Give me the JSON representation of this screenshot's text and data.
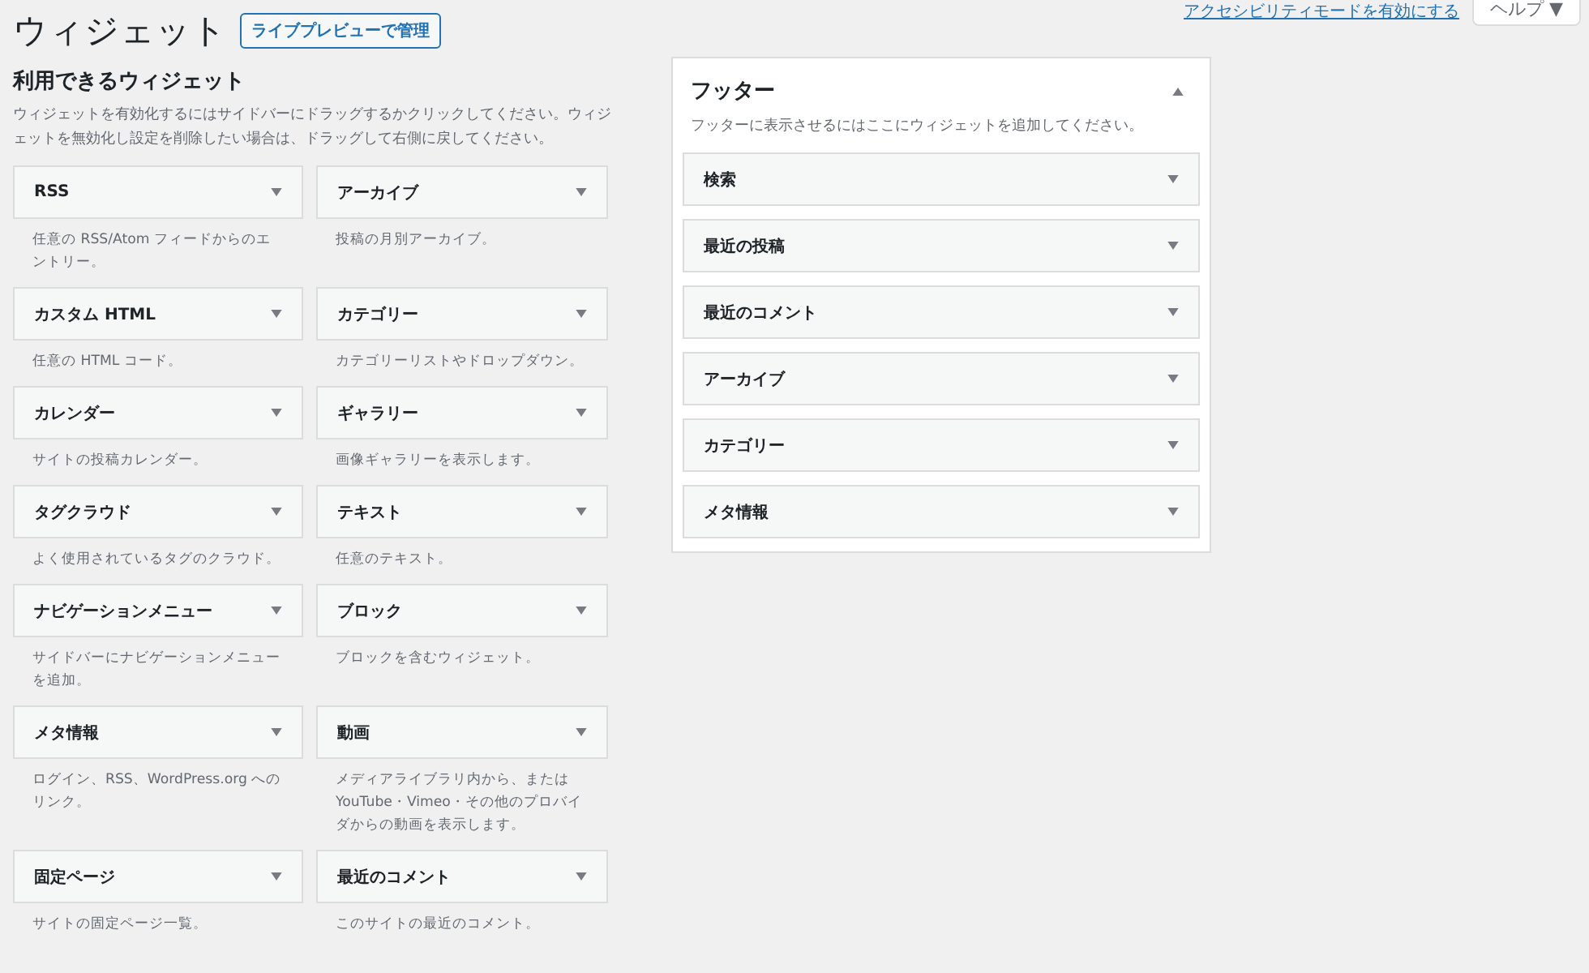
{
  "screen_meta": {
    "accessibility_link": "アクセシビリティモードを有効にする",
    "help_button": "ヘルプ ▼"
  },
  "page_title": "ウィジェット",
  "live_preview_button": "ライブプレビューで管理",
  "available_widgets": {
    "heading": "利用できるウィジェット",
    "description": "ウィジェットを有効化するにはサイドバーにドラッグするかクリックしてください。ウィジェットを無効化し設定を削除したい場合は、ドラッグして右側に戻してください。",
    "widgets": [
      {
        "title": "RSS",
        "description": "任意の RSS/Atom フィードからのエントリー。"
      },
      {
        "title": "アーカイブ",
        "description": "投稿の月別アーカイブ。"
      },
      {
        "title": "カスタム HTML",
        "description": "任意の HTML コード。"
      },
      {
        "title": "カテゴリー",
        "description": "カテゴリーリストやドロップダウン。"
      },
      {
        "title": "カレンダー",
        "description": "サイトの投稿カレンダー。"
      },
      {
        "title": "ギャラリー",
        "description": "画像ギャラリーを表示します。"
      },
      {
        "title": "タグクラウド",
        "description": "よく使用されているタグのクラウド。"
      },
      {
        "title": "テキスト",
        "description": "任意のテキスト。"
      },
      {
        "title": "ナビゲーションメニュー",
        "description": "サイドバーにナビゲーションメニューを追加。"
      },
      {
        "title": "ブロック",
        "description": "ブロックを含むウィジェット。"
      },
      {
        "title": "メタ情報",
        "description": "ログイン、RSS、WordPress.org へのリンク。"
      },
      {
        "title": "動画",
        "description": "メディアライブラリ内から、または YouTube・Vimeo・その他のプロバイダからの動画を表示します。"
      },
      {
        "title": "固定ページ",
        "description": "サイトの固定ページ一覧。"
      },
      {
        "title": "最近のコメント",
        "description": "このサイトの最近のコメント。"
      }
    ]
  },
  "sidebar": {
    "title": "フッター",
    "expanded": true,
    "description": "フッターに表示させるにはここにウィジェットを追加してください。",
    "widgets": [
      {
        "title": "検索"
      },
      {
        "title": "最近の投稿"
      },
      {
        "title": "最近のコメント"
      },
      {
        "title": "アーカイブ"
      },
      {
        "title": "カテゴリー"
      },
      {
        "title": "メタ情報"
      }
    ]
  }
}
